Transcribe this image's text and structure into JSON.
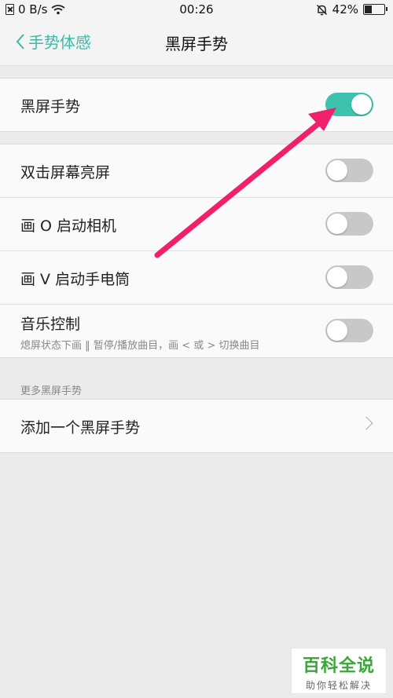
{
  "status_bar": {
    "network_speed": "0 B/s",
    "time": "00:26",
    "battery": "42%",
    "battery_level": 0.42
  },
  "nav": {
    "back_label": "手势体感",
    "title": "黑屏手势"
  },
  "group1": {
    "item_label": "黑屏手势",
    "enabled": true
  },
  "group2": {
    "items": [
      {
        "label": "双击屏幕亮屏",
        "enabled": false
      },
      {
        "label": "画 O 启动相机",
        "enabled": false
      },
      {
        "label": "画 V 启动手电筒",
        "enabled": false
      },
      {
        "label": "音乐控制",
        "sublabel": "熄屏状态下画 ‖ 暂停/播放曲目，画 < 或 > 切换曲目",
        "enabled": false
      }
    ]
  },
  "more_section": {
    "header": "更多黑屏手势",
    "add_label": "添加一个黑屏手势"
  },
  "watermark": {
    "title": "百科全说",
    "subtitle": "助你轻松解决"
  },
  "colors": {
    "accent": "#3cc2ae",
    "annotation_arrow": "#f0206a"
  }
}
